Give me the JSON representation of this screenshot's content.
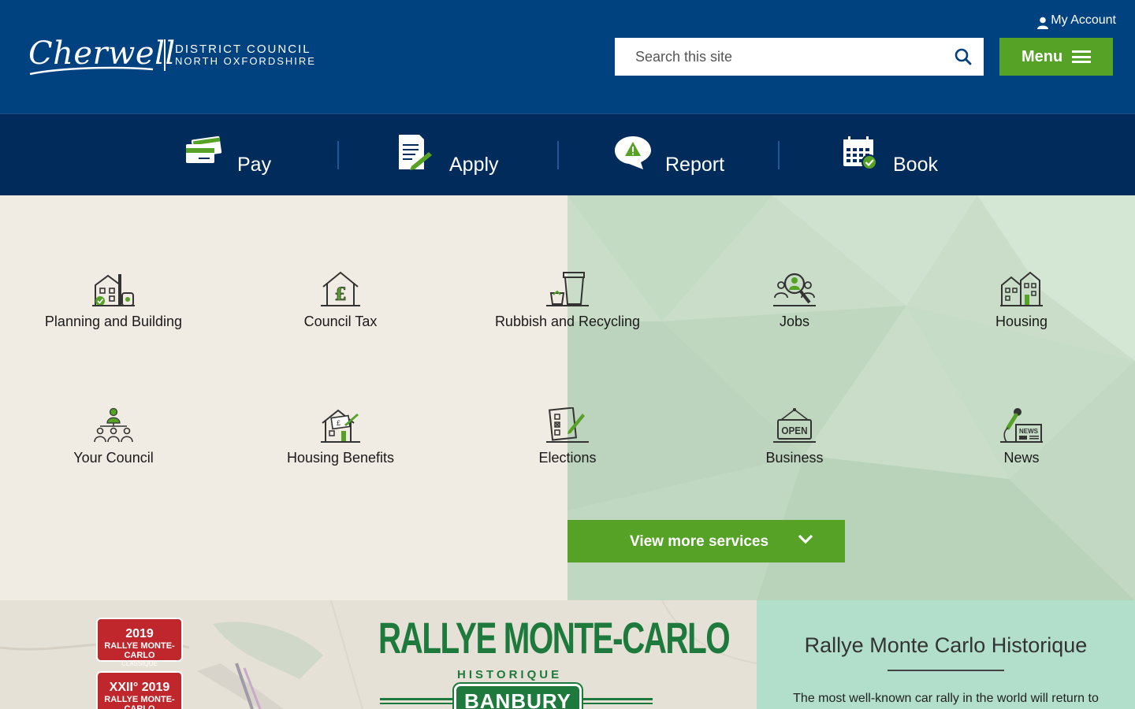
{
  "header": {
    "logo_word": "Cherwell",
    "logo_line1": "DISTRICT COUNCIL",
    "logo_line2": "NORTH OXFORDSHIRE",
    "account_label": "My Account",
    "search_placeholder": "Search this site",
    "menu_label": "Menu"
  },
  "actions": [
    {
      "label": "Pay",
      "icon": "credit-cards-icon"
    },
    {
      "label": "Apply",
      "icon": "form-pen-icon"
    },
    {
      "label": "Report",
      "icon": "warning-bubble-icon"
    },
    {
      "label": "Book",
      "icon": "calendar-check-icon"
    }
  ],
  "services": [
    {
      "label": "Planning and Building",
      "icon": "planning-building-icon"
    },
    {
      "label": "Council Tax",
      "icon": "council-tax-icon"
    },
    {
      "label": "Rubbish and Recycling",
      "icon": "rubbish-bin-icon"
    },
    {
      "label": "Jobs",
      "icon": "jobs-search-icon"
    },
    {
      "label": "Housing",
      "icon": "housing-icon"
    },
    {
      "label": "Your Council",
      "icon": "your-council-icon"
    },
    {
      "label": "Housing Benefits",
      "icon": "housing-benefits-icon"
    },
    {
      "label": "Elections",
      "icon": "elections-ballot-icon"
    },
    {
      "label": "Business",
      "icon": "business-open-sign-icon"
    },
    {
      "label": "News",
      "icon": "news-icon"
    }
  ],
  "more_services_label": "View more services",
  "feature": {
    "title": "Rallye Monte Carlo Historique",
    "text": "The most well-known car rally in the world will return to",
    "banner_title": "RALLYE MONTE-CARLO",
    "banner_sub": "HISTORIQUE",
    "banner_town": "BANBURY",
    "badge1_year": "2019",
    "badge1_line": "RALLYE MONTE-CARLO",
    "badge1_small": "CLASSIQUE",
    "badge2_year": "XXII° 2019",
    "badge2_line": "RALLYE MONTE-CARLO"
  },
  "colors": {
    "header_blue": "#00417f",
    "action_navy": "#002b5a",
    "accent_green": "#56a227",
    "panel_mint": "#b2dfcb"
  }
}
